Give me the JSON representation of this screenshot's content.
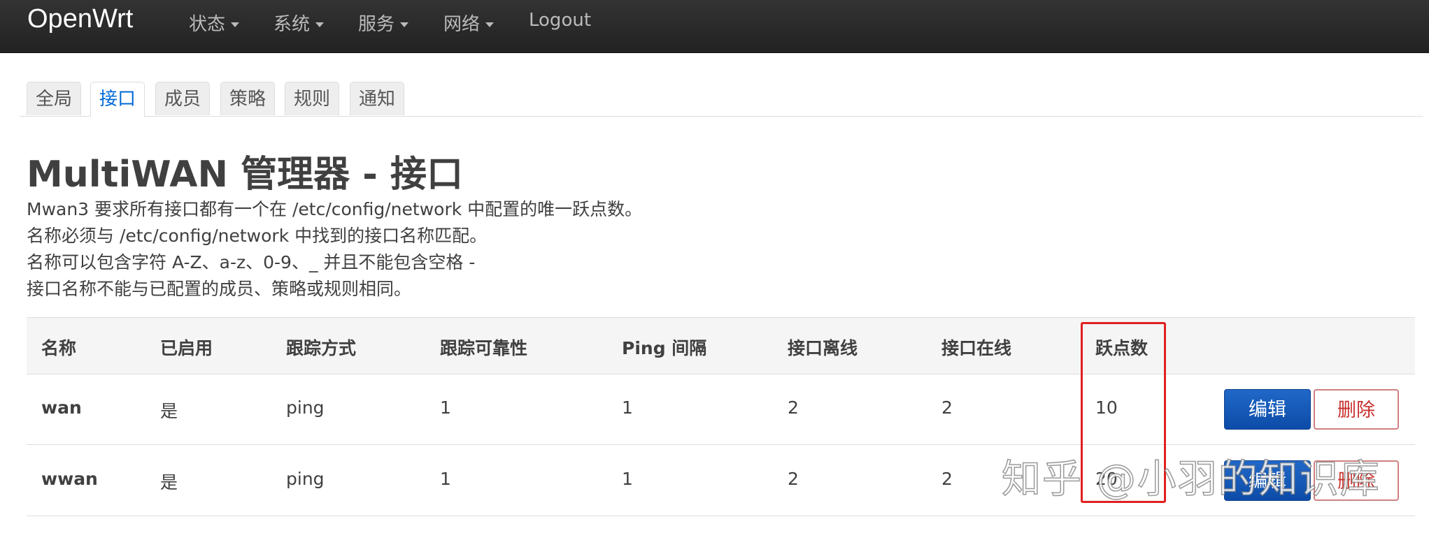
{
  "navbar": {
    "brand": "OpenWrt",
    "menu": [
      {
        "label": "状态",
        "dropdown": true
      },
      {
        "label": "系统",
        "dropdown": true
      },
      {
        "label": "服务",
        "dropdown": true
      },
      {
        "label": "网络",
        "dropdown": true
      },
      {
        "label": "Logout",
        "dropdown": false
      }
    ]
  },
  "tabs": [
    {
      "label": "全局",
      "active": false
    },
    {
      "label": "接口",
      "active": true
    },
    {
      "label": "成员",
      "active": false
    },
    {
      "label": "策略",
      "active": false
    },
    {
      "label": "规则",
      "active": false
    },
    {
      "label": "通知",
      "active": false
    }
  ],
  "page": {
    "title": "MultiWAN 管理器 - 接口",
    "description": [
      "Mwan3 要求所有接口都有一个在 /etc/config/network 中配置的唯一跃点数。",
      "名称必须与 /etc/config/network 中找到的接口名称匹配。",
      "名称可以包含字符 A-Z、a-z、0-9、_ 并且不能包含空格 -",
      "接口名称不能与已配置的成员、策略或规则相同。"
    ]
  },
  "table": {
    "headers": [
      "名称",
      "已启用",
      "跟踪方式",
      "跟踪可靠性",
      "Ping 间隔",
      "接口离线",
      "接口在线",
      "跃点数"
    ],
    "rows": [
      {
        "name": "wan",
        "enabled": "是",
        "track_method": "ping",
        "reliability": "1",
        "ping_interval": "1",
        "down": "2",
        "up": "2",
        "metric": "10"
      },
      {
        "name": "wwan",
        "enabled": "是",
        "track_method": "ping",
        "reliability": "1",
        "ping_interval": "1",
        "down": "2",
        "up": "2",
        "metric": "20"
      }
    ],
    "edit_label": "编辑",
    "delete_label": "删除"
  },
  "watermark": "知乎 @小羽的知识库",
  "colors": {
    "navbar_bg": "#222222",
    "active_tab_text": "#0069d6",
    "edit_button": "#0d4ca8",
    "delete_button_text": "#c9302c",
    "highlight_box": "#e02020"
  }
}
